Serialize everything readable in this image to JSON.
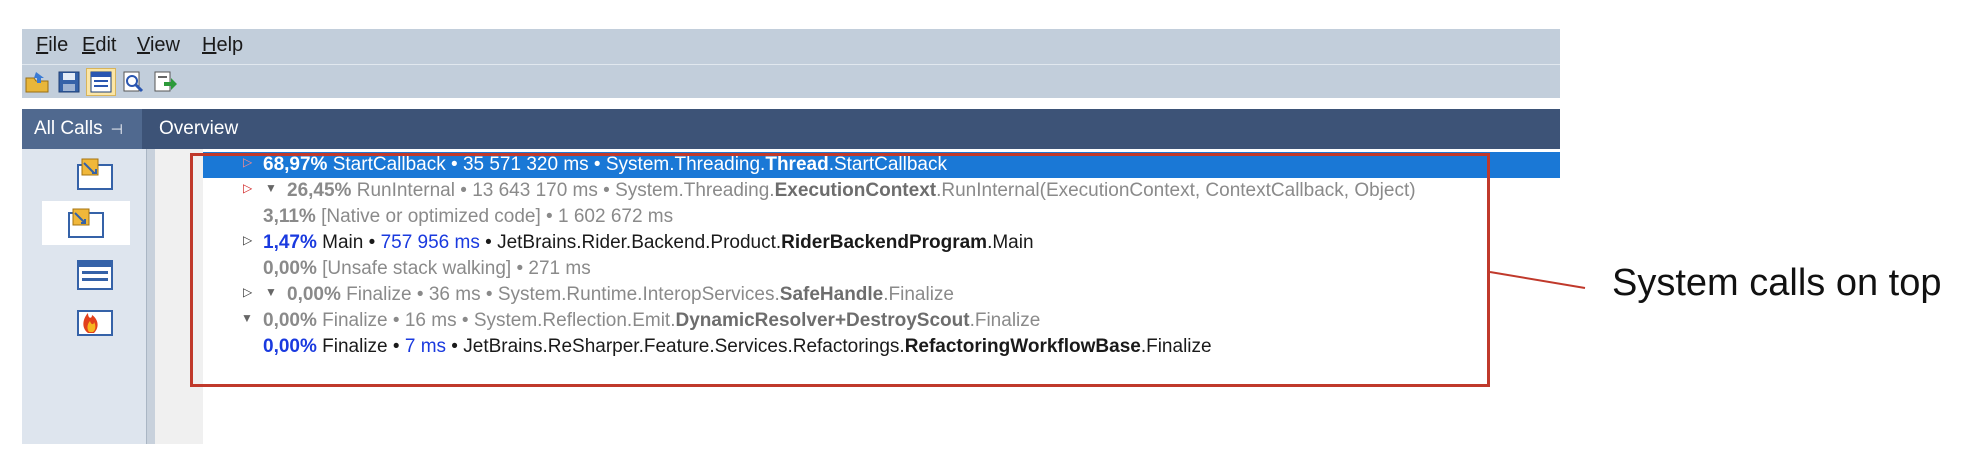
{
  "menu": {
    "items": [
      {
        "mnemonic": "F",
        "rest": "ile"
      },
      {
        "mnemonic": "E",
        "rest": "dit"
      },
      {
        "mnemonic": "V",
        "rest": "iew"
      },
      {
        "mnemonic": "H",
        "rest": "elp"
      }
    ]
  },
  "toolbar": {
    "icons": [
      "open-icon",
      "save-icon",
      "snapshot-icon",
      "find-icon",
      "export-icon"
    ]
  },
  "tabs": {
    "all_calls": "All Calls",
    "pin_glyph": "⊣",
    "overview": "Overview"
  },
  "sidebar": {
    "icons": [
      "call-tree-icon",
      "hotspots-icon",
      "threads-icon",
      "flame-icon"
    ]
  },
  "tree": {
    "rows": [
      {
        "pct": "68,97%",
        "sep1": " StartCallback",
        "sep2": " • ",
        "time": "35 571 320 ms",
        "sep3": " • ",
        "ns": "System.Threading.",
        "cls": "Thread",
        "method": ".StartCallback"
      },
      {
        "pct": "26,45%",
        "sep1": " RunInternal",
        "sep2": " • ",
        "time": "13 643 170 ms",
        "sep3": " • ",
        "ns": "System.Threading.",
        "cls": "ExecutionContext",
        "method": ".RunInternal(ExecutionContext, ContextCallback, Object)"
      },
      {
        "pct": "3,11%",
        "sep1": " [Native or optimized code]",
        "sep2": " • ",
        "time": "1 602 672 ms"
      },
      {
        "pct": "1,47%",
        "sep1": " Main",
        "sep2": " • ",
        "time": "757 956 ms",
        "sep3": " • ",
        "ns": "JetBrains.Rider.Backend.Product.",
        "cls": "RiderBackendProgram",
        "method": ".Main"
      },
      {
        "pct": "0,00%",
        "sep1": " [Unsafe stack walking]",
        "sep2": " • ",
        "time": "271 ms"
      },
      {
        "pct": "0,00%",
        "sep1": " Finalize",
        "sep2": " • ",
        "time": "36 ms",
        "sep3": " • ",
        "ns": "System.Runtime.InteropServices.",
        "cls": "SafeHandle",
        "method": ".Finalize"
      },
      {
        "pct": "0,00%",
        "sep1": " Finalize",
        "sep2": " • ",
        "time": "16 ms",
        "sep3": " • ",
        "ns": "System.Reflection.Emit.",
        "cls": "DynamicResolver+DestroyScout",
        "method": ".Finalize"
      },
      {
        "pct": "0,00%",
        "sep1": " Finalize",
        "sep2": " • ",
        "time": "7 ms",
        "sep3": " • ",
        "ns": "JetBrains.ReSharper.Feature.Services.Refactorings.",
        "cls": "RefactoringWorkflowBase",
        "method": ".Finalize"
      }
    ]
  },
  "annotation": {
    "text": "System calls on top"
  },
  "colors": {
    "highlight_box": "#c0392b",
    "selection": "#1a78d6",
    "tab_strip": "#3d5377",
    "menu_bg": "#c2cedb"
  }
}
